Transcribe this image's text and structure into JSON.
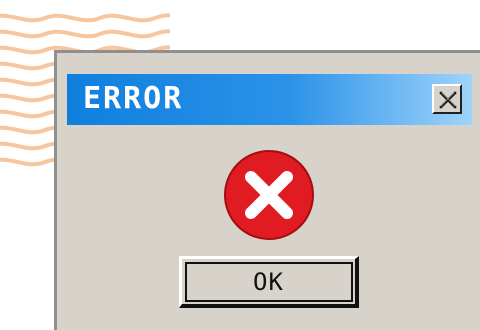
{
  "dialog": {
    "title": "ERROR",
    "close_icon": "close-icon",
    "ok_label": "OK",
    "status_icon": "error-icon"
  },
  "colors": {
    "titlebar_start": "#0f7fde",
    "titlebar_end": "#9fd4fb",
    "window_face": "#d7d2ca",
    "error_red": "#e11b22",
    "pattern_orange": "#f3b889"
  }
}
